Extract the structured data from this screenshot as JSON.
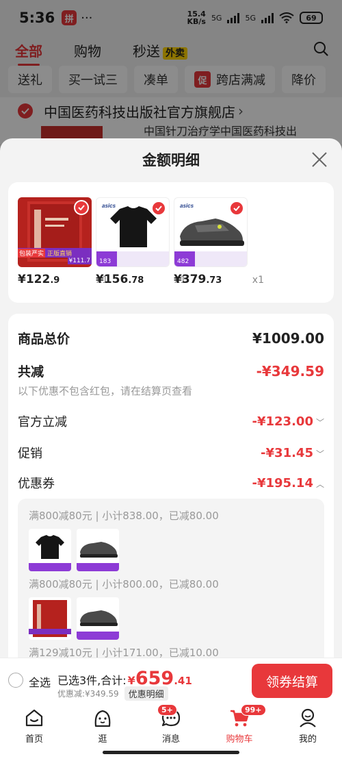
{
  "status_bar": {
    "time": "5:36",
    "app_icon_text": "拼",
    "dots": "···",
    "speed_value": "15.4",
    "speed_unit": "KB/s",
    "net1": "5G",
    "net2": "5G",
    "battery": "69"
  },
  "top_tabs": {
    "all": "全部",
    "purchased": "购物",
    "flash": "秒送",
    "takeout_badge": "外卖"
  },
  "chips": [
    "送礼",
    "买一试三",
    "凑单",
    "跨店满减",
    "降价"
  ],
  "chip_promo_icon": "促",
  "shop": {
    "name": "中国医药科技出版社官方旗舰店",
    "arrow": "›",
    "sub_text": "中国针刀治疗学中国医药科技出"
  },
  "sheet": {
    "title": "金额明细",
    "products": [
      {
        "price_int": "¥122",
        "price_dec": ".9",
        "qty": "x1"
      },
      {
        "price_int": "¥156",
        "price_dec": ".78",
        "qty": "x1"
      },
      {
        "price_int": "¥379",
        "price_dec": ".73",
        "qty": "x1"
      }
    ],
    "product_tags": {
      "book_tag1": "包装严实",
      "book_tag2": "正版直销",
      "book_price": "¥111.7",
      "brand": "asics",
      "shirt_price": "183",
      "shoe_price": "482"
    },
    "total": {
      "label": "商品总价",
      "value": "¥1009.00"
    },
    "reduce": {
      "label": "共减",
      "value": "-¥349.59",
      "note": "以下优惠不包含红包，请在结算页查看"
    },
    "official": {
      "label": "官方立减",
      "value": "-¥123.00"
    },
    "promo": {
      "label": "促销",
      "value": "-¥31.45"
    },
    "coupon": {
      "label": "优惠券",
      "value": "-¥195.14"
    },
    "coupon_lines": [
      "满800减80元 | 小计838.00，已减80.00",
      "满800减80元 | 小计800.00，已减80.00",
      "满129减10元 | 小计171.00，已减10.00"
    ]
  },
  "checkout": {
    "select_all": "全选",
    "summary_label": "已选3件,合计:",
    "yen": "¥",
    "total_int": "659",
    "total_dec": ".41",
    "discount_text": "优惠减:¥349.59",
    "detail_button": "优惠明细",
    "pay_button": "领券结算"
  },
  "bottom_nav": [
    {
      "label": "首页"
    },
    {
      "label": "逛"
    },
    {
      "label": "消息",
      "badge": "5+"
    },
    {
      "label": "购物车",
      "badge": "99+"
    },
    {
      "label": "我的"
    }
  ],
  "colors": {
    "accent": "#e8383b",
    "sheet_bg": "#f3f3f3"
  }
}
